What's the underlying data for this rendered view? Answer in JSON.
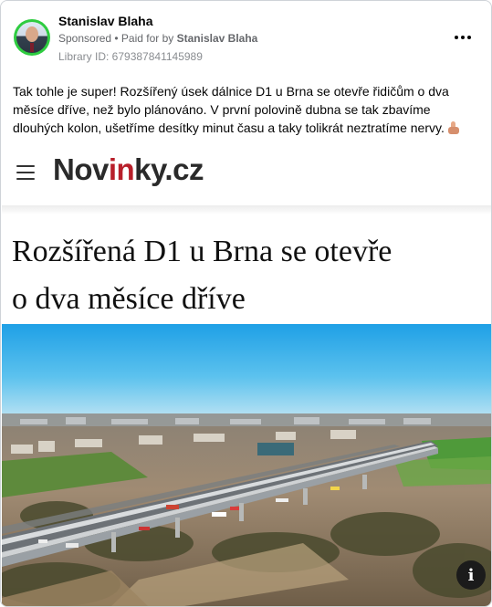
{
  "ad": {
    "page_name": "Stanislav Blaha",
    "sponsored_label": "Sponsored",
    "paid_for_prefix": " • Paid for by ",
    "paid_for_name": "Stanislav Blaha",
    "library_id": "Library ID: 679387841145989",
    "more_icon": "more-horizontal-icon",
    "post_text": "Tak tohle je super! Rozšířený úsek dálnice D1 u Brna se otevře řidičům o dva měsíce dříve, než bylo plánováno. V první polovině dubna se tak zbavíme dlouhých kolon, ušetříme desítky minut času a taky tolikrát neztratíme nervy.",
    "post_emoji": "thumbs-up-emoji"
  },
  "creative": {
    "logo_part1": "Nov",
    "logo_part2": "in",
    "logo_part3": "ky.cz",
    "headline_line1": "Rozšířená D1 u Brna se otevře",
    "headline_line2": "o dva měsíce dříve",
    "photo_subject": "aerial photo of widened D1 highway bridge near Brno",
    "info_label": "i"
  },
  "colors": {
    "avatar_ring": "#2ecc40",
    "logo_red": "#b81f2a",
    "logo_dark": "#2a2a2a",
    "sky": "#2aa8e6"
  }
}
